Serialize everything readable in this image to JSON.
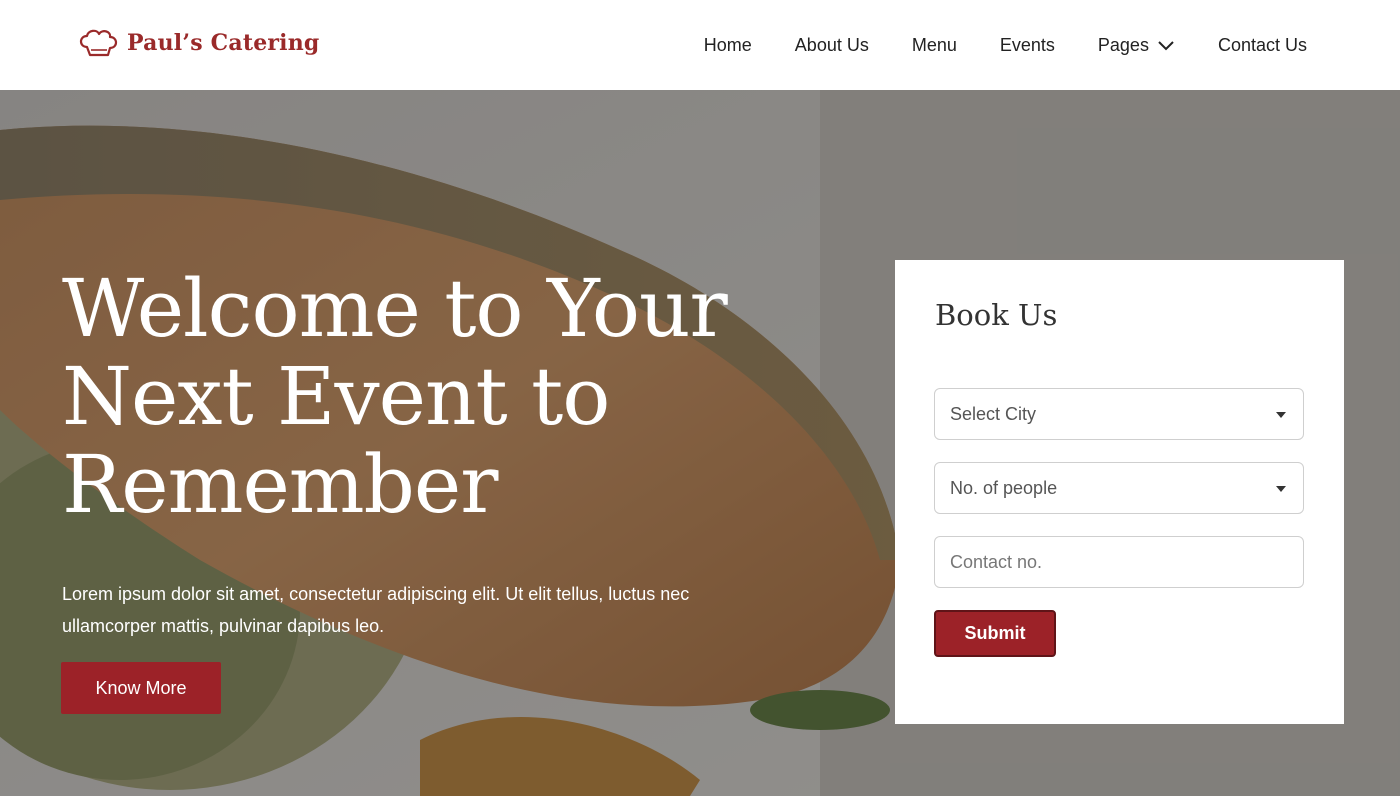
{
  "brand": {
    "name": "Paul’s Catering",
    "color": "#9a2a2a"
  },
  "nav": {
    "home": "Home",
    "about": "About Us",
    "menu": "Menu",
    "events": "Events",
    "pages": "Pages",
    "contact": "Contact Us"
  },
  "hero": {
    "line1": "Welcome to Your",
    "line2": "Next Event to",
    "line3": "Remember",
    "lead_line1": "Lorem ipsum dolor sit amet, consectetur adipiscing elit. Ut elit tellus, luctus nec",
    "lead_line2": "ullamcorper mattis, pulvinar dapibus leo.",
    "cta": "Know More"
  },
  "booking": {
    "title": "Book Us",
    "city_placeholder": "Select City",
    "people_placeholder": "No. of people",
    "contact_placeholder": "Contact no.",
    "submit": "Submit"
  },
  "colors": {
    "accent": "#9c2228",
    "text": "#222222"
  },
  "icons": {
    "logo": "chef-hat-icon",
    "nav_pages": "chevron-down-icon",
    "select": "caret-down-icon"
  }
}
